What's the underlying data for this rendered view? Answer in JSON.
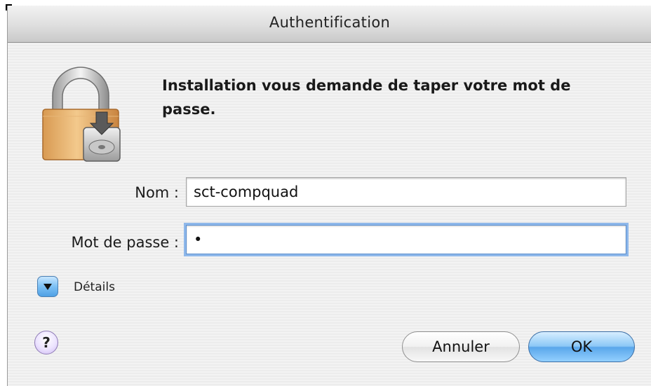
{
  "window": {
    "title": "Authentification"
  },
  "dialog": {
    "message": "Installation vous demande de taper votre mot de passe.",
    "lock_icon": "lock-with-installer-disk-icon"
  },
  "form": {
    "name_label": "Nom :",
    "name_value": "sct-compquad",
    "password_label": "Mot de passe :",
    "password_masked": "•"
  },
  "details": {
    "label": "Détails",
    "icon": "disclosure-triangle-down-icon"
  },
  "help": {
    "label": "?",
    "icon": "help-icon"
  },
  "buttons": {
    "cancel_label": "Annuler",
    "ok_label": "OK"
  },
  "colors": {
    "accent": "#5aa6ea",
    "focus_ring": "#8fb8ea"
  }
}
